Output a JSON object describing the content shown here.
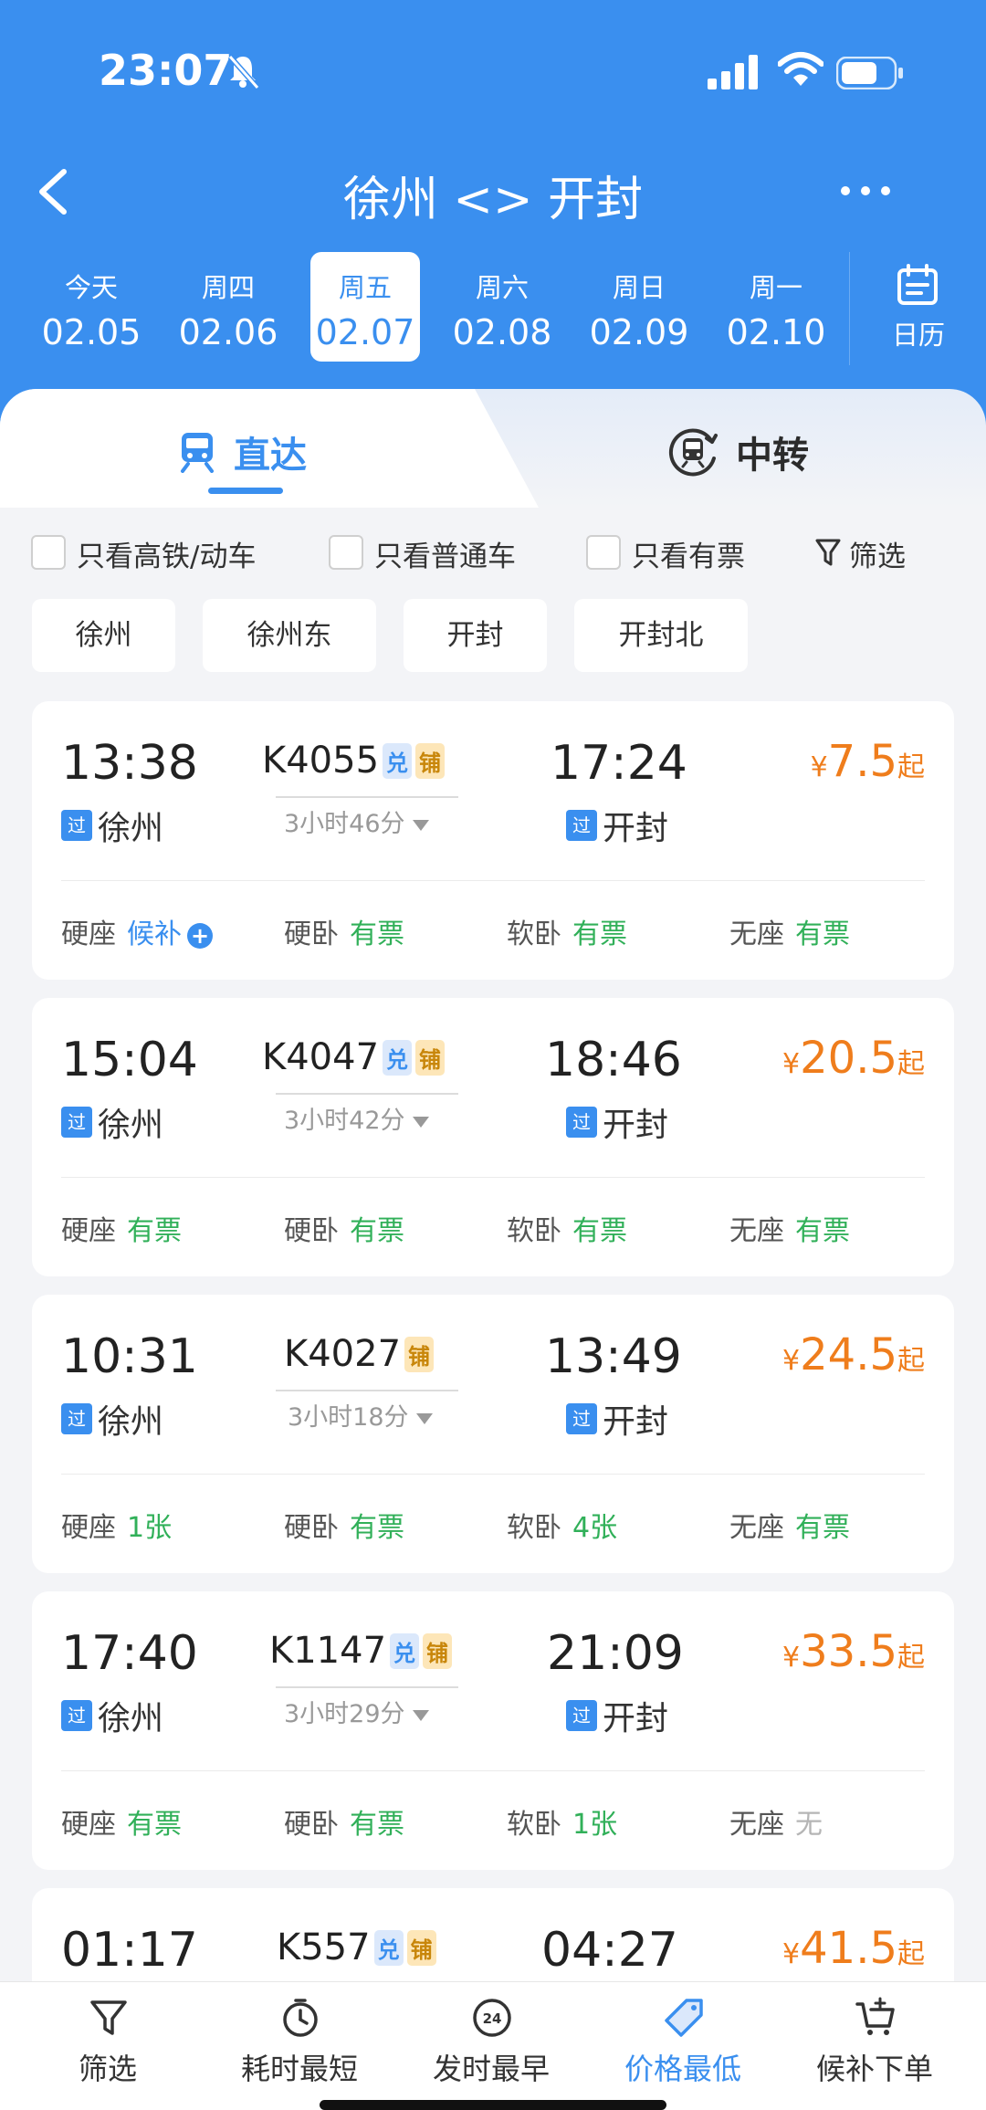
{
  "status": {
    "time": "23:07"
  },
  "nav": {
    "title": "徐州 <> 开封"
  },
  "dates": [
    {
      "weekday": "今天",
      "date": "02.05"
    },
    {
      "weekday": "周四",
      "date": "02.06"
    },
    {
      "weekday": "周五",
      "date": "02.07",
      "selected": true
    },
    {
      "weekday": "周六",
      "date": "02.08"
    },
    {
      "weekday": "周日",
      "date": "02.09"
    },
    {
      "weekday": "周一",
      "date": "02.10"
    }
  ],
  "calendar_label": "日历",
  "tabs": {
    "direct": "直达",
    "transfer": "中转"
  },
  "filters": {
    "gaotie": "只看高铁/动车",
    "putong": "只看普通车",
    "youpiao": "只看有票",
    "filter": "筛选"
  },
  "stations": [
    "徐州",
    "徐州东",
    "开封",
    "开封北"
  ],
  "labels": {
    "guo": "过",
    "currency": "¥",
    "qi": "起"
  },
  "trains": [
    {
      "dep": "13:38",
      "arr": "17:24",
      "no": "K4055",
      "dui": "兑",
      "pu": "铺",
      "duration": "3小时46分",
      "from": "徐州",
      "to": "开封",
      "price": "7.5",
      "seats": [
        {
          "name": "硬座",
          "value": "候补",
          "plus": "+"
        },
        {
          "name": "硬卧",
          "value": "有票"
        },
        {
          "name": "软卧",
          "value": "有票"
        },
        {
          "name": "无座",
          "value": "有票"
        }
      ]
    },
    {
      "dep": "15:04",
      "arr": "18:46",
      "no": "K4047",
      "dui": "兑",
      "pu": "铺",
      "duration": "3小时42分",
      "from": "徐州",
      "to": "开封",
      "price": "20.5",
      "seats": [
        {
          "name": "硬座",
          "value": "有票"
        },
        {
          "name": "硬卧",
          "value": "有票"
        },
        {
          "name": "软卧",
          "value": "有票"
        },
        {
          "name": "无座",
          "value": "有票"
        }
      ]
    },
    {
      "dep": "10:31",
      "arr": "13:49",
      "no": "K4027",
      "pu": "铺",
      "duration": "3小时18分",
      "from": "徐州",
      "to": "开封",
      "price": "24.5",
      "seats": [
        {
          "name": "硬座",
          "value": "1张"
        },
        {
          "name": "硬卧",
          "value": "有票"
        },
        {
          "name": "软卧",
          "value": "4张"
        },
        {
          "name": "无座",
          "value": "有票"
        }
      ]
    },
    {
      "dep": "17:40",
      "arr": "21:09",
      "no": "K1147",
      "dui": "兑",
      "pu": "铺",
      "duration": "3小时29分",
      "from": "徐州",
      "to": "开封",
      "price": "33.5",
      "seats": [
        {
          "name": "硬座",
          "value": "有票"
        },
        {
          "name": "硬卧",
          "value": "有票"
        },
        {
          "name": "软卧",
          "value": "1张"
        },
        {
          "name": "无座",
          "value": "无"
        }
      ]
    },
    {
      "dep": "01:17",
      "arr": "04:27",
      "no": "K557",
      "dui": "兑",
      "pu": "铺",
      "price": "41.5"
    }
  ],
  "bottom": {
    "filter": "筛选",
    "shortest": "耗时最短",
    "earliest": "发时最早",
    "cheapest": "价格最低",
    "waitlist": "候补下单",
    "clock24": "24"
  },
  "colors": {
    "brand": "#3a8fef",
    "price": "#ef7d1c",
    "available": "#31b059",
    "none": "#b5b5b5"
  }
}
